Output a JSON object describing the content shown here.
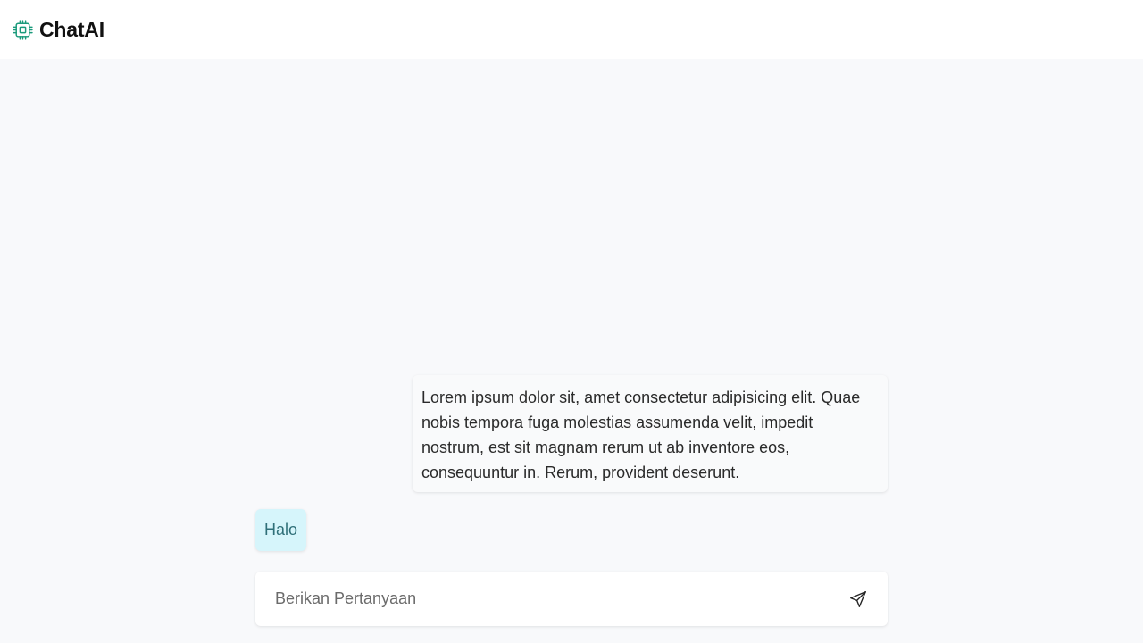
{
  "header": {
    "brand_name": "ChatAI",
    "brand_icon": "chip-icon",
    "brand_icon_color": "#1a9a7b"
  },
  "messages": [
    {
      "role": "bot",
      "text": "Lorem ipsum dolor sit, amet consectetur adipisicing elit. Quae nobis tempora fuga molestias assumenda velit, impedit nostrum, est sit magnam rerum ut ab inventore eos, consequuntur in. Rerum, provident deserunt."
    },
    {
      "role": "user",
      "text": "Halo"
    }
  ],
  "composer": {
    "placeholder": "Berikan Pertanyaan",
    "value": "",
    "send_icon": "send-icon"
  },
  "colors": {
    "background": "#f8f9fb",
    "user_bubble": "#d6f5fb",
    "user_text": "#2f6f78",
    "bot_bubble": "#f9fafb"
  }
}
